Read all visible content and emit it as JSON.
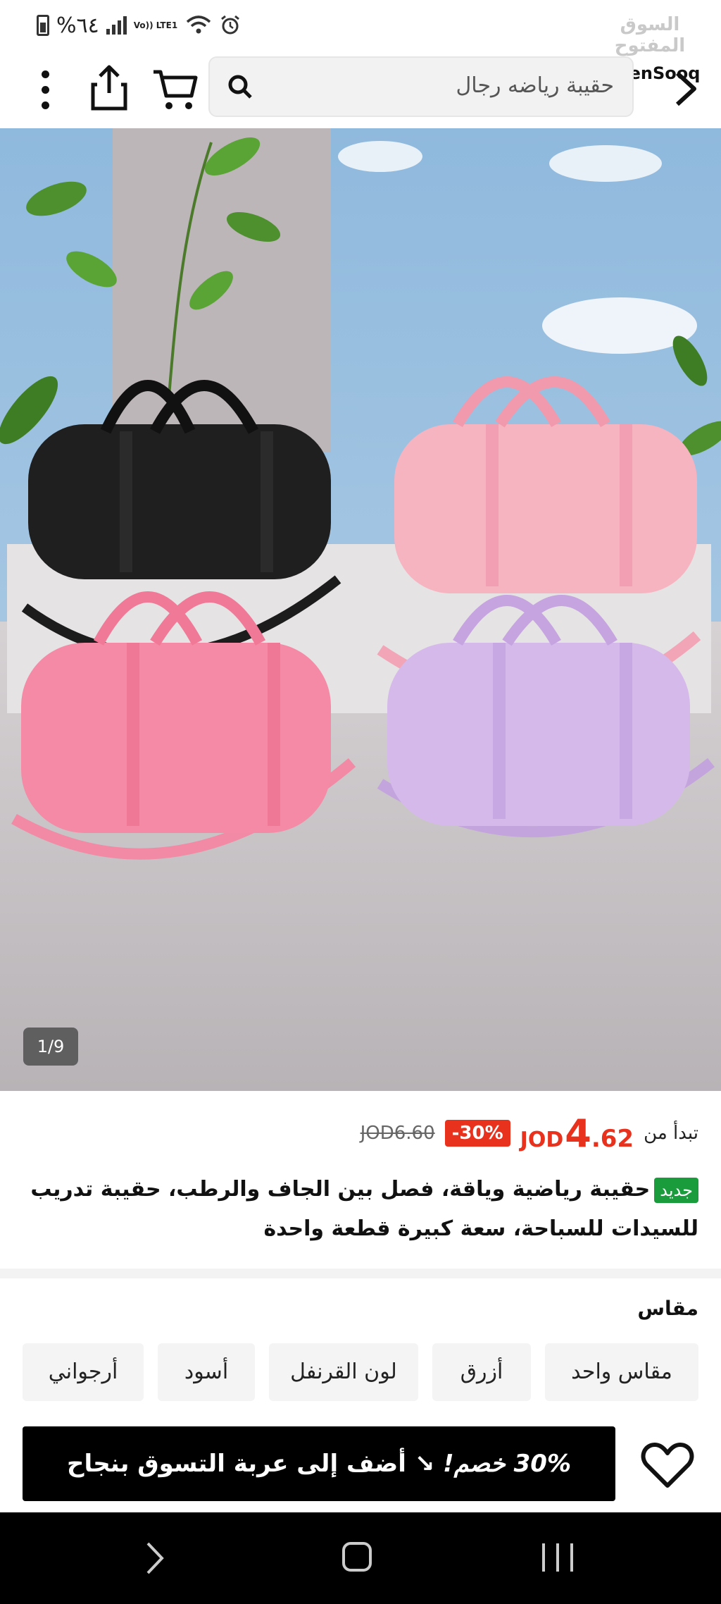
{
  "status_bar": {
    "battery_text": "%٦٤",
    "volte": "Vo)) LTE1",
    "brand_ar": "السوق المفتوح",
    "brand_en": "OpenSooq"
  },
  "nav": {
    "search_query": "حقيبة رياضه رجال"
  },
  "gallery": {
    "counter": "1/9"
  },
  "price": {
    "from_label": "تبدأ من",
    "currency": "JOD",
    "integer": "4",
    "decimal": ".62",
    "discount": "-30%",
    "old_price": "JOD6.60"
  },
  "product": {
    "badge": "جديد",
    "title": "حقيبة رياضية وياقة، فصل بين الجاف والرطب، حقيبة تدريب للسيدات للسباحة، سعة كبيرة قطعة واحدة"
  },
  "size": {
    "label": "مقاس",
    "options": [
      "مقاس واحد",
      "أزرق",
      "لون القرنفل",
      "أسود",
      "أرجواني"
    ]
  },
  "bottom": {
    "promo": "30% خصم!",
    "add_to_cart": "أضف إلى عربة التسوق بنجاح"
  },
  "colors": {
    "price_red": "#e8321e",
    "new_green": "#1a9b3c"
  }
}
